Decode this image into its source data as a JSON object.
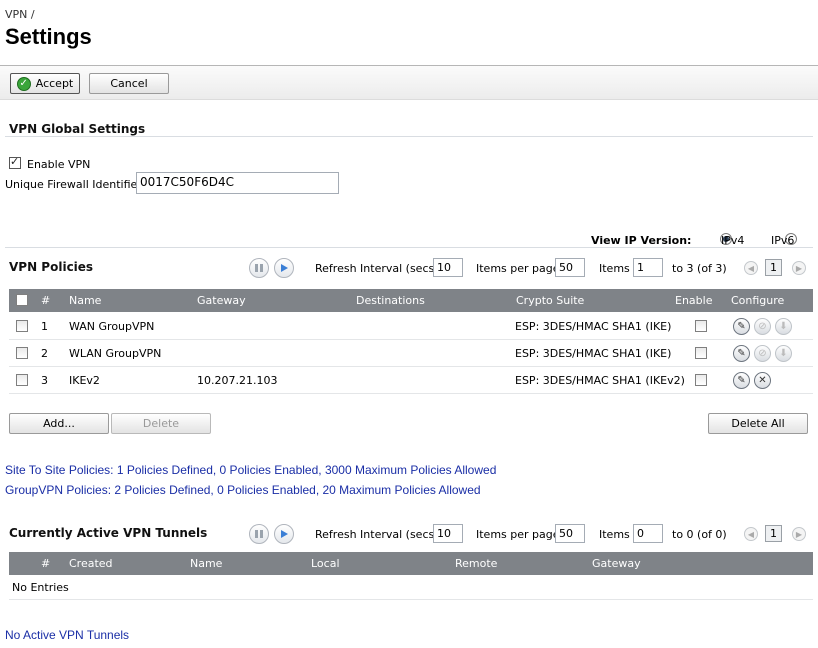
{
  "header": {
    "breadcrumb": "VPN /",
    "title": "Settings"
  },
  "toolbar": {
    "accept_label": "Accept",
    "cancel_label": "Cancel"
  },
  "global": {
    "section_title": "VPN Global Settings",
    "enable_vpn_label": "Enable VPN",
    "enable_vpn_checked": true,
    "uid_label": "Unique Firewall Identifier:",
    "uid_value": "0017C50F6D4C"
  },
  "ipversion": {
    "label": "View IP Version:",
    "options": [
      "IPv4",
      "IPv6"
    ],
    "selected": "IPv4"
  },
  "policies": {
    "section_title": "VPN Policies",
    "refresh_label": "Refresh Interval (secs)",
    "refresh_value": "10",
    "per_page_label": "Items per page",
    "per_page_value": "50",
    "items_label": "Items",
    "items_value": "1",
    "range_text": "to 3 (of 3)",
    "page": "1",
    "columns": [
      "#",
      "Name",
      "Gateway",
      "Destinations",
      "Crypto Suite",
      "Enable",
      "Configure"
    ],
    "rows": [
      {
        "num": "1",
        "name": "WAN GroupVPN",
        "gateway": "",
        "destinations": "",
        "crypto": "ESP: 3DES/HMAC SHA1 (IKE)"
      },
      {
        "num": "2",
        "name": "WLAN GroupVPN",
        "gateway": "",
        "destinations": "",
        "crypto": "ESP: 3DES/HMAC SHA1 (IKE)"
      },
      {
        "num": "3",
        "name": "IKEv2",
        "gateway": "10.207.21.103",
        "destinations": "",
        "crypto": "ESP: 3DES/HMAC SHA1 (IKEv2)"
      }
    ],
    "add_label": "Add...",
    "delete_label": "Delete",
    "delete_all_label": "Delete All",
    "site_summary": "Site To Site Policies: 1 Policies Defined, 0 Policies Enabled, 3000 Maximum Policies Allowed",
    "group_summary": "GroupVPN Policies: 2 Policies Defined, 0 Policies Enabled, 20 Maximum Policies Allowed"
  },
  "tunnels": {
    "section_title": "Currently Active VPN Tunnels",
    "refresh_label": "Refresh Interval (secs)",
    "refresh_value": "10",
    "per_page_label": "Items per page",
    "per_page_value": "50",
    "items_label": "Items",
    "items_value": "0",
    "range_text": "to 0 (of 0)",
    "page": "1",
    "columns": [
      "#",
      "Created",
      "Name",
      "Local",
      "Remote",
      "Gateway"
    ],
    "empty_text": "No Entries",
    "footer_link": "No Active VPN Tunnels"
  },
  "colors": {
    "header_bar": "#7f8388",
    "link": "#1a2ea6",
    "accent_blue": "#3b7fd6"
  }
}
